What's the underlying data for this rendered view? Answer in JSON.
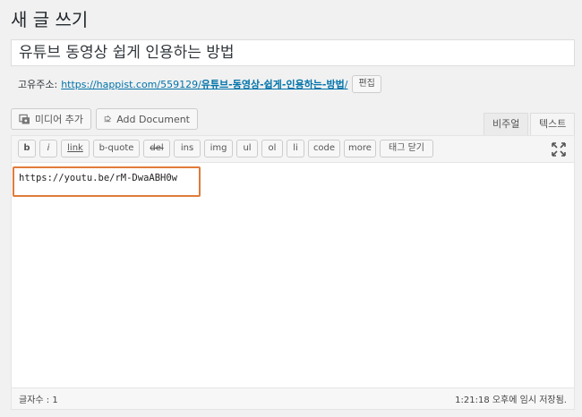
{
  "page": {
    "title": "새 글 쓰기"
  },
  "post": {
    "title": "유튜브 동영상 쉽게 인용하는 방법"
  },
  "permalink": {
    "label": "고유주소:",
    "url_base": "https://happist.com/559129/",
    "url_slug": "유튜브-동영상-쉽게-인용하는-방법",
    "url_trailing": "/",
    "edit_label": "편집"
  },
  "media": {
    "add_media_label": "미디어 추가",
    "add_document_label": "Add Document"
  },
  "tabs": {
    "visual": "비주얼",
    "text": "텍스트"
  },
  "toolbar": {
    "buttons": [
      "b",
      "i",
      "link",
      "b-quote",
      "del",
      "ins",
      "img",
      "ul",
      "ol",
      "li",
      "code",
      "more",
      "태그 닫기"
    ]
  },
  "content": {
    "text": "https://youtu.be/rM-DwaABH0w"
  },
  "status": {
    "word_count_label": "글자수 : 1",
    "saved_text": "1:21:18 오후에 임시 저장됨."
  },
  "colors": {
    "highlight": "#e07b39",
    "link": "#0073aa"
  }
}
